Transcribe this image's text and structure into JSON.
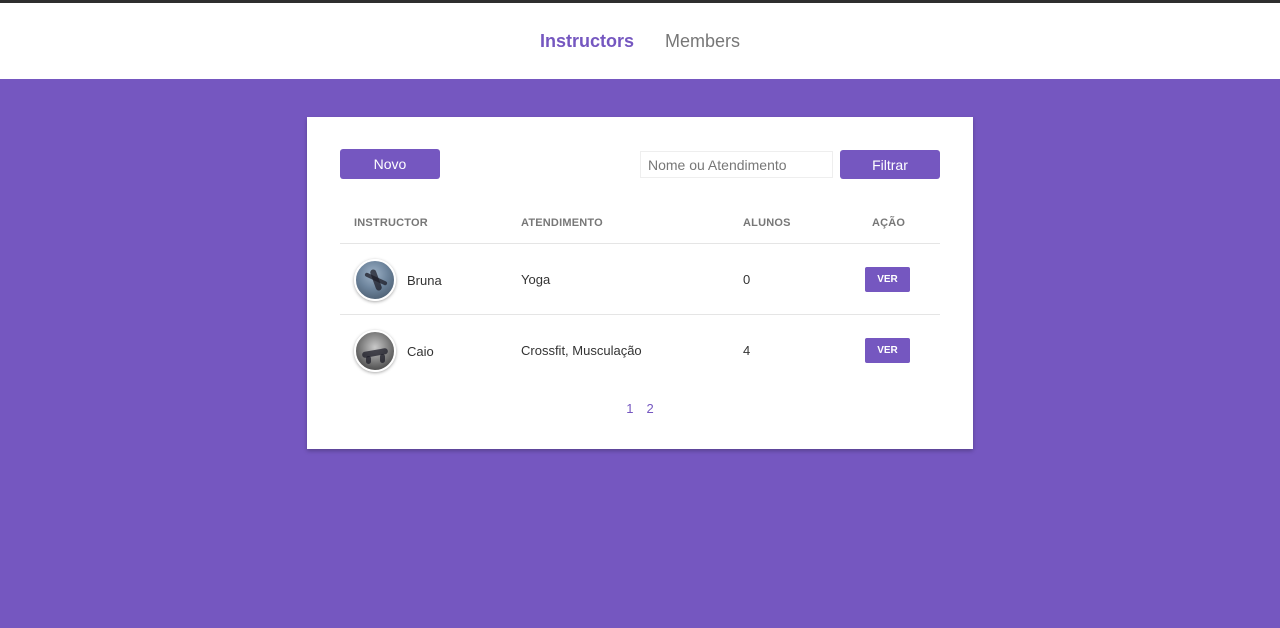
{
  "nav": {
    "items": [
      {
        "label": "Instructors",
        "active": true
      },
      {
        "label": "Members",
        "active": false
      }
    ]
  },
  "toolbar": {
    "new_label": "Novo",
    "search_placeholder": "Nome ou Atendimento",
    "search_value": "",
    "filter_label": "Filtrar"
  },
  "table": {
    "headers": [
      "INSTRUCTOR",
      "ATENDIMENTO",
      "ALUNOS",
      "AÇÃO"
    ],
    "rows": [
      {
        "name": "Bruna",
        "services": "Yoga",
        "students": "0",
        "action": "VER"
      },
      {
        "name": "Caio",
        "services": "Crossfit, Musculação",
        "students": "4",
        "action": "VER"
      }
    ]
  },
  "pagination": {
    "pages": [
      "1",
      "2"
    ]
  },
  "colors": {
    "accent": "#7557c0",
    "background": "#7557c0",
    "text": "#333333",
    "muted": "#777777"
  }
}
